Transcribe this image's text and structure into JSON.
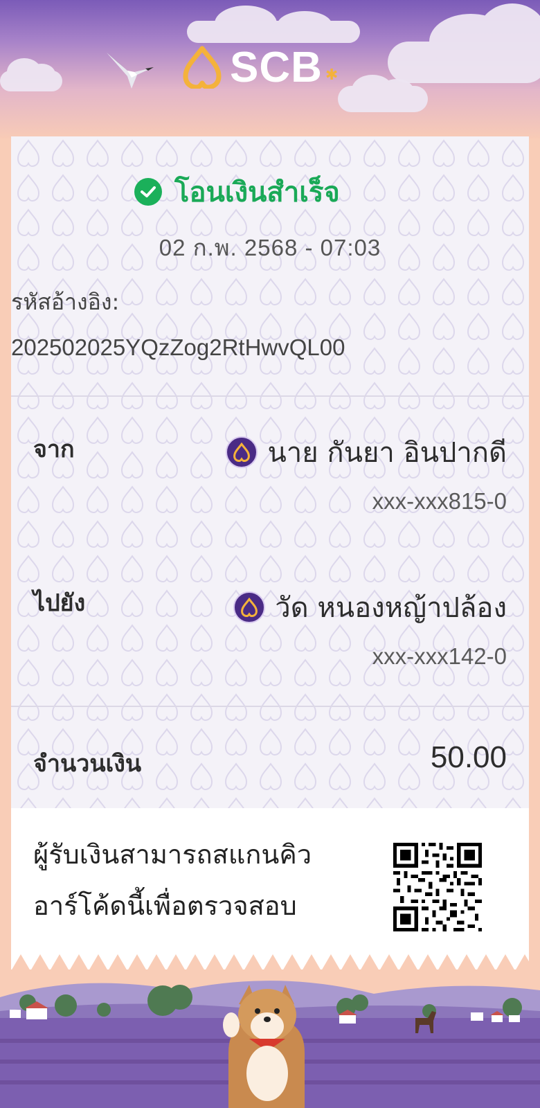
{
  "header": {
    "brand": "SCB"
  },
  "receipt": {
    "status": "โอนเงินสำเร็จ",
    "datetime": "02 ก.พ. 2568 - 07:03",
    "ref_label": "รหัสอ้างอิง:",
    "ref_value": "202502025YQzZog2RtHwvQL00",
    "from": {
      "label": "จาก",
      "name": "นาย กันยา อินปากดี",
      "account": "xxx-xxx815-0"
    },
    "to": {
      "label": "ไปยัง",
      "name": "วัด หนองหญ้าปล้อง",
      "account": "xxx-xxx142-0"
    },
    "amount": {
      "label": "จำนวนเงิน",
      "value": "50.00"
    },
    "verify": {
      "line1": "ผู้รับเงินสามารถสแกนคิว",
      "line2": "อาร์โค้ดนี้เพื่อตรวจสอบ"
    }
  },
  "colors": {
    "success": "#1aa957",
    "brand_purple": "#4a2b85",
    "brand_gold": "#f4b23b"
  }
}
